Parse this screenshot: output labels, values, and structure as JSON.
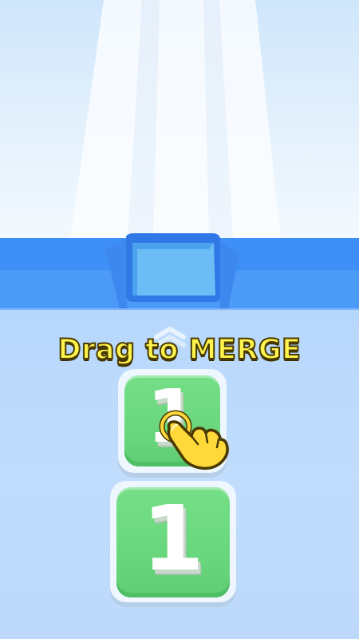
{
  "instruction": {
    "text": "Drag to MERGE",
    "color": "#fff34d",
    "outline_color": "#4a3a00"
  },
  "tiles": [
    {
      "value": "1",
      "face_color": "#6fda82",
      "position": "top"
    },
    {
      "value": "1",
      "face_color": "#6fda82",
      "position": "bottom"
    }
  ],
  "colors": {
    "wall": "#3d8ff7",
    "floor": "#bcd9fc",
    "slot": "#6cbcf6",
    "track": "#f6fbff"
  },
  "icons": {
    "gesture": "hand-pointer-icon",
    "direction": "chevron-up-icon"
  }
}
